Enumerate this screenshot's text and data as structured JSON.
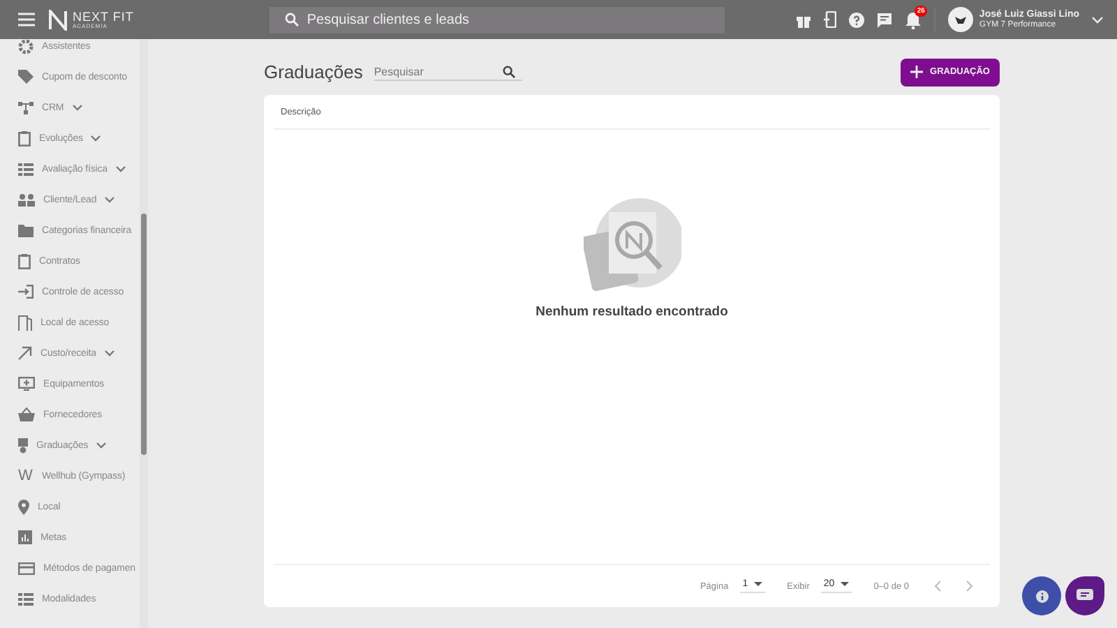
{
  "topbar": {
    "logo_title": "NEXT FIT",
    "logo_subtitle": "ACADEMIA",
    "search": {
      "placeholder": "Pesquisar clientes e leads"
    },
    "notifications_badge": "26",
    "user": {
      "name": "José Luiz Giassi Lino",
      "gym": "GYM 7 Performance"
    }
  },
  "sidebar": {
    "items": [
      {
        "label": "Assistentes",
        "expandable": false
      },
      {
        "label": "Cupom de desconto",
        "expandable": false
      },
      {
        "label": "CRM",
        "expandable": true
      },
      {
        "label": "Evoluções",
        "expandable": true
      },
      {
        "label": "Avaliação física",
        "expandable": true
      },
      {
        "label": "Cliente/Lead",
        "expandable": true
      },
      {
        "label": "Categorias financeira",
        "expandable": false
      },
      {
        "label": "Contratos",
        "expandable": false
      },
      {
        "label": "Controle de acesso",
        "expandable": false
      },
      {
        "label": "Local de acesso",
        "expandable": false
      },
      {
        "label": "Custo/receita",
        "expandable": true
      },
      {
        "label": "Equipamentos",
        "expandable": false
      },
      {
        "label": "Fornecedores",
        "expandable": false
      },
      {
        "label": "Graduações",
        "expandable": true
      },
      {
        "label": "Wellhub (Gympass)",
        "glyph": "W",
        "expandable": false
      },
      {
        "label": "Local",
        "expandable": false
      },
      {
        "label": "Metas",
        "expandable": false
      },
      {
        "label": "Métodos de pagamen",
        "expandable": false
      },
      {
        "label": "Modalidades",
        "expandable": false
      }
    ]
  },
  "page": {
    "title": "Graduações",
    "search": {
      "placeholder": "Pesquisar"
    },
    "add_button": "GRADUAÇÃO"
  },
  "table": {
    "columns": [
      "Descrição"
    ],
    "empty_message": "Nenhum resultado encontrado"
  },
  "pagination": {
    "page_label": "Página",
    "page_value": "1",
    "show_label": "Exibir",
    "show_value": "20",
    "range": "0–0 de 0"
  }
}
